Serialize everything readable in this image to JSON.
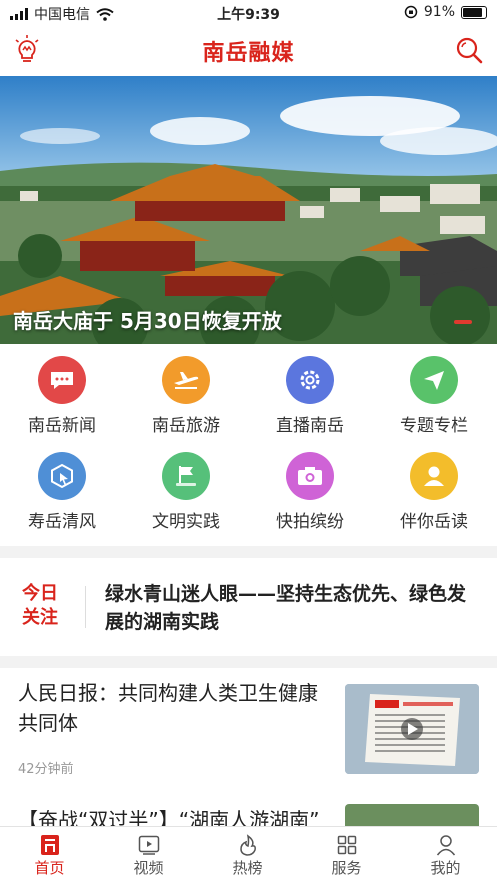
{
  "status": {
    "carrier": "中国电信",
    "time": "上午9:39",
    "battery": "91%"
  },
  "header": {
    "title": "南岳融媒"
  },
  "banner": {
    "caption": "南岳大庙于 5月30日恢复开放"
  },
  "grid": [
    {
      "label": "南岳新闻",
      "color": "#e24848"
    },
    {
      "label": "南岳旅游",
      "color": "#f29b2b"
    },
    {
      "label": "直播南岳",
      "color": "#5b76de"
    },
    {
      "label": "专题专栏",
      "color": "#59c26a"
    },
    {
      "label": "寿岳清风",
      "color": "#4f8fd6"
    },
    {
      "label": "文明实践",
      "color": "#56c07a"
    },
    {
      "label": "快拍缤纷",
      "color": "#cf63d6"
    },
    {
      "label": "伴你岳读",
      "color": "#f3bd2b"
    }
  ],
  "today": {
    "tag": "今日关注",
    "headline": "绿水青山迷人眼——坚持生态优先、绿色发展的湖南实践"
  },
  "news": [
    {
      "title": "人民日报：共同构建人类卫生健康共同体",
      "time": "42分钟前"
    },
    {
      "title": "【奋战“双过半”】“湖南人游湖南”"
    }
  ],
  "tabs": [
    {
      "label": "首页"
    },
    {
      "label": "视频"
    },
    {
      "label": "热榜"
    },
    {
      "label": "服务"
    },
    {
      "label": "我的"
    }
  ],
  "accent": "#d9241c"
}
